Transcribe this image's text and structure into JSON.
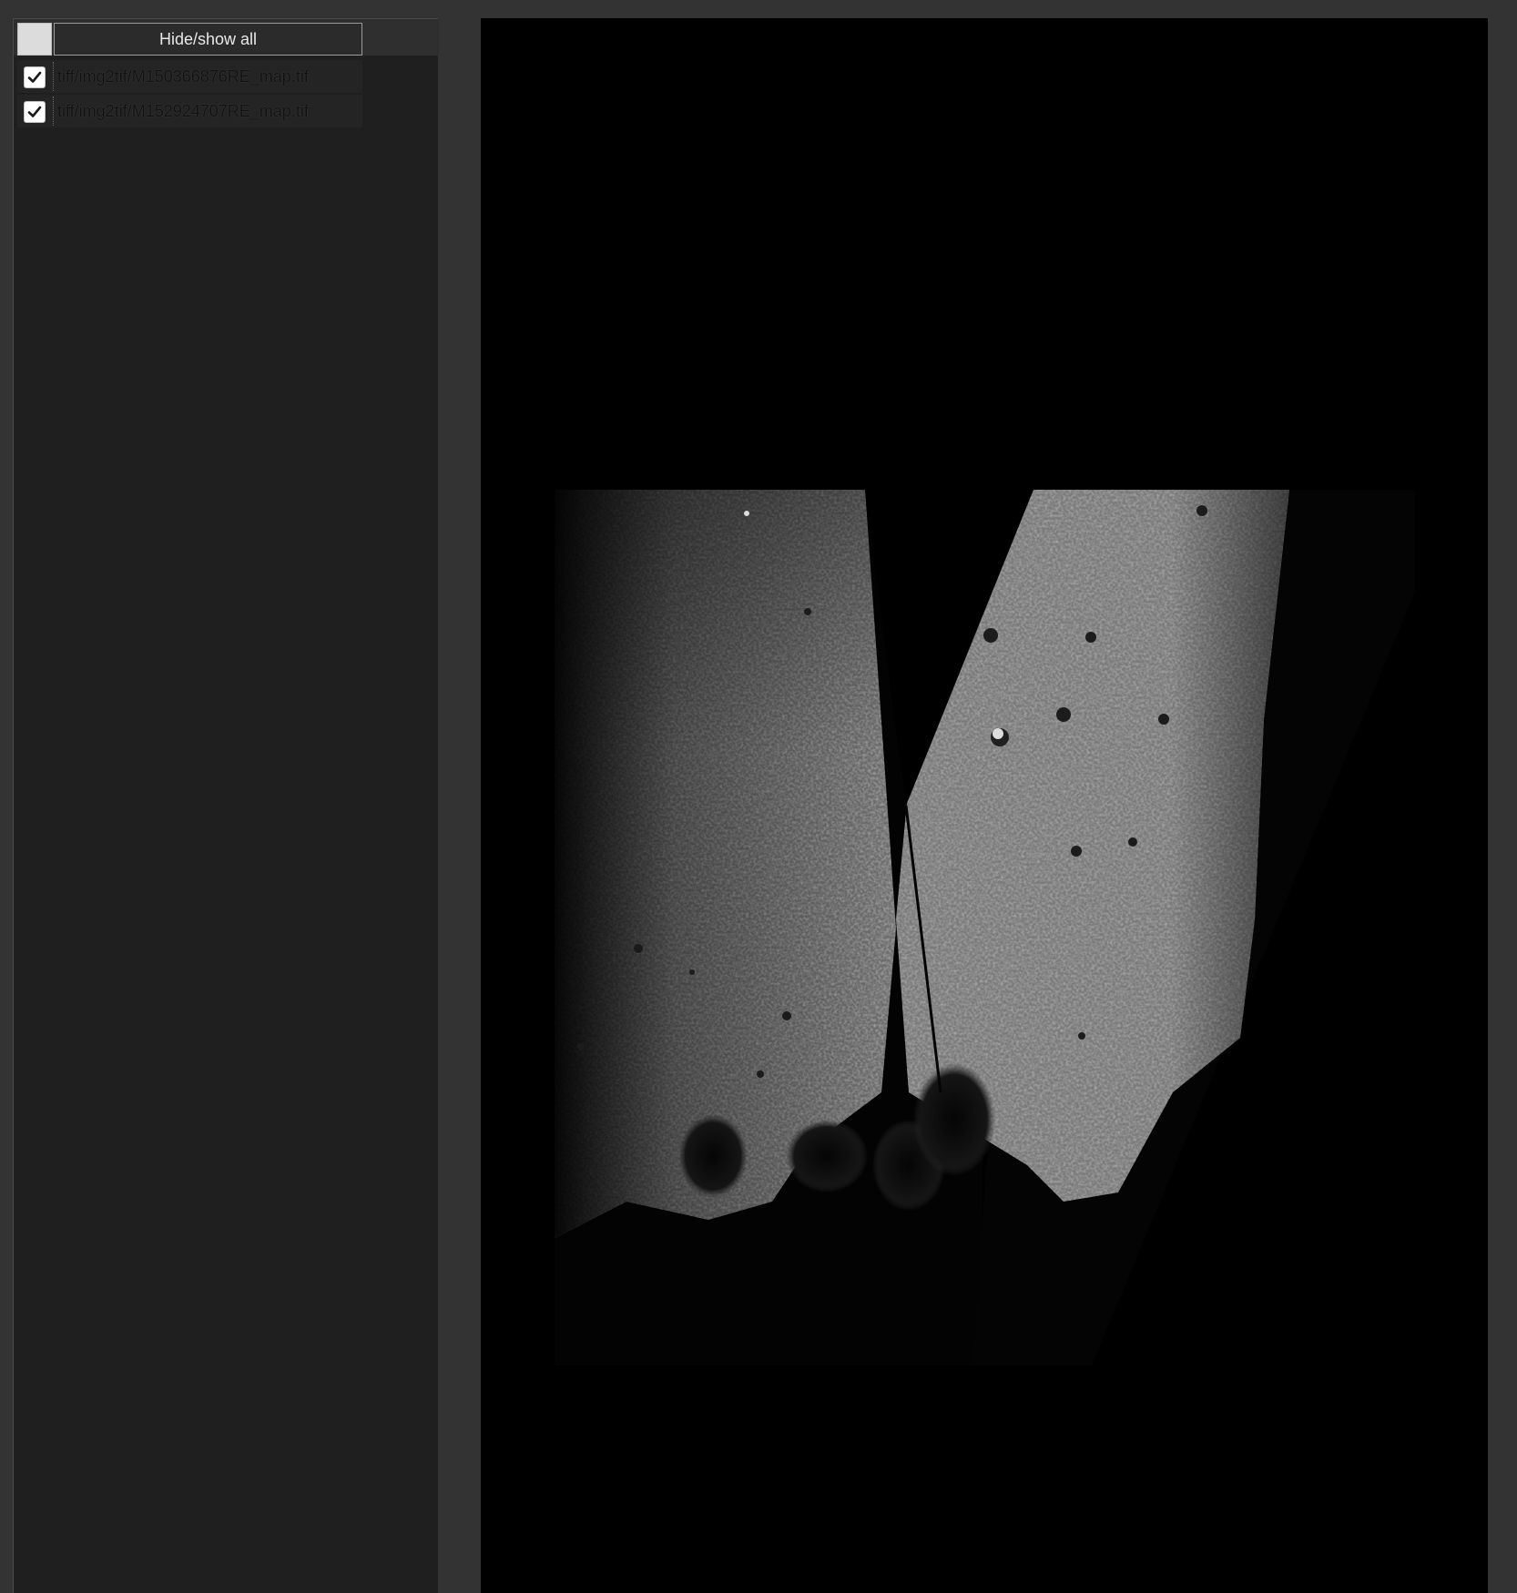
{
  "layer_panel": {
    "hide_show_all_label": "Hide/show all",
    "layers": [
      {
        "name": "tiff/img2tif/M150366876RE_map.tif",
        "visible": true
      },
      {
        "name": "tiff/img2tif/M152924707RE_map.tif",
        "visible": true
      }
    ]
  },
  "colors": {
    "app_background": "#333333",
    "panel_background": "#1f1f1f",
    "viewer_background": "#000000"
  },
  "icons": {
    "checkbox": "check-mark"
  }
}
